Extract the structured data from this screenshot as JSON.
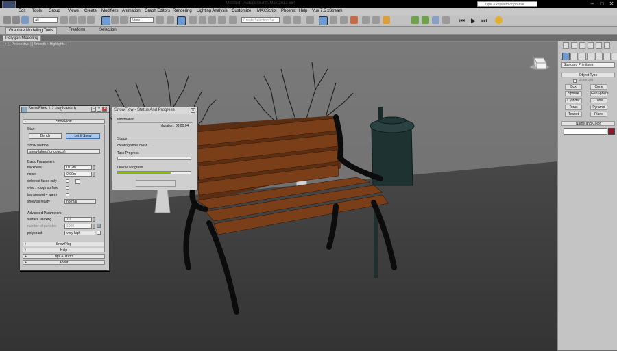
{
  "window": {
    "title": "Untitled - Autodesk 3ds Max 2012 x64",
    "help_placeholder": "Type a keyword or phrase"
  },
  "menu": [
    "Edit",
    "Tools",
    "Group",
    "Views",
    "Create",
    "Modifiers",
    "Animation",
    "Graph Editors",
    "Rendering",
    "Lighting Analysis",
    "Customize",
    "MAXScript",
    "Phoenix",
    "Help",
    "Vue 7.5 xStream"
  ],
  "toolbar": {
    "selection_filter": "All",
    "reference_coord": "View",
    "selection_set": "Create Selection Se"
  },
  "ribbon": {
    "tabs": [
      "Graphite Modeling Tools",
      "Freeform",
      "Selection"
    ],
    "subtab": "Polygon Modeling"
  },
  "viewport": {
    "label": "[ + ] [ Perspective ] [ Smooth + Highlights ]"
  },
  "command_panel": {
    "dropdown": "Standard Primitives",
    "object_type_title": "Object Type",
    "autogrid": "AutoGrid",
    "primitives": [
      "Box",
      "Cone",
      "Sphere",
      "GeoSphere",
      "Cylinder",
      "Tube",
      "Torus",
      "Pyramid",
      "Teapot",
      "Plane"
    ],
    "name_color_title": "Name and Color",
    "color": "#8b1a2a"
  },
  "snowflow": {
    "title": "SnowFlow 1.2 (registered)",
    "rollout_main": "SnowFlow",
    "start_label": "Start",
    "bench_btn": "Bench",
    "letitsnow_btn": "Let It Snow",
    "snow_method_label": "Snow Method",
    "snow_method_value": "snowflakes (for objects)",
    "basic_params_label": "Basic Parameters",
    "thickness_label": "thickness",
    "thickness_value": "0,02m",
    "noise_label": "noise",
    "noise_value": "0,00m",
    "selected_faces_label": "selected faces only",
    "wind_label": "wind / rough surface",
    "transparent_label": "transparent = warm",
    "snowfall_label": "snowfall reality",
    "snowfall_value": "normal",
    "advanced_label": "Advanced Parameters",
    "surface_relaxing_label": "surface relaxing",
    "surface_relaxing_value": "10",
    "particles_label": "number of particles",
    "particles_value": "1000",
    "polycount_label": "polycount",
    "polycount_value": "very high",
    "rollouts": [
      "SnowPlug",
      "Help",
      "Tips & Tricks",
      "About"
    ]
  },
  "status_window": {
    "title": "SnowFlow - Status And Progress",
    "information_label": "Information",
    "duration": "duration: 00:00:04",
    "status_label": "Status",
    "status_text": "creating snow mesh...",
    "task_progress_label": "Task Progress",
    "task_progress": 0,
    "overall_progress_label": "Overall Progress",
    "overall_progress": 0.73,
    "progress_color": "#7fc000"
  }
}
